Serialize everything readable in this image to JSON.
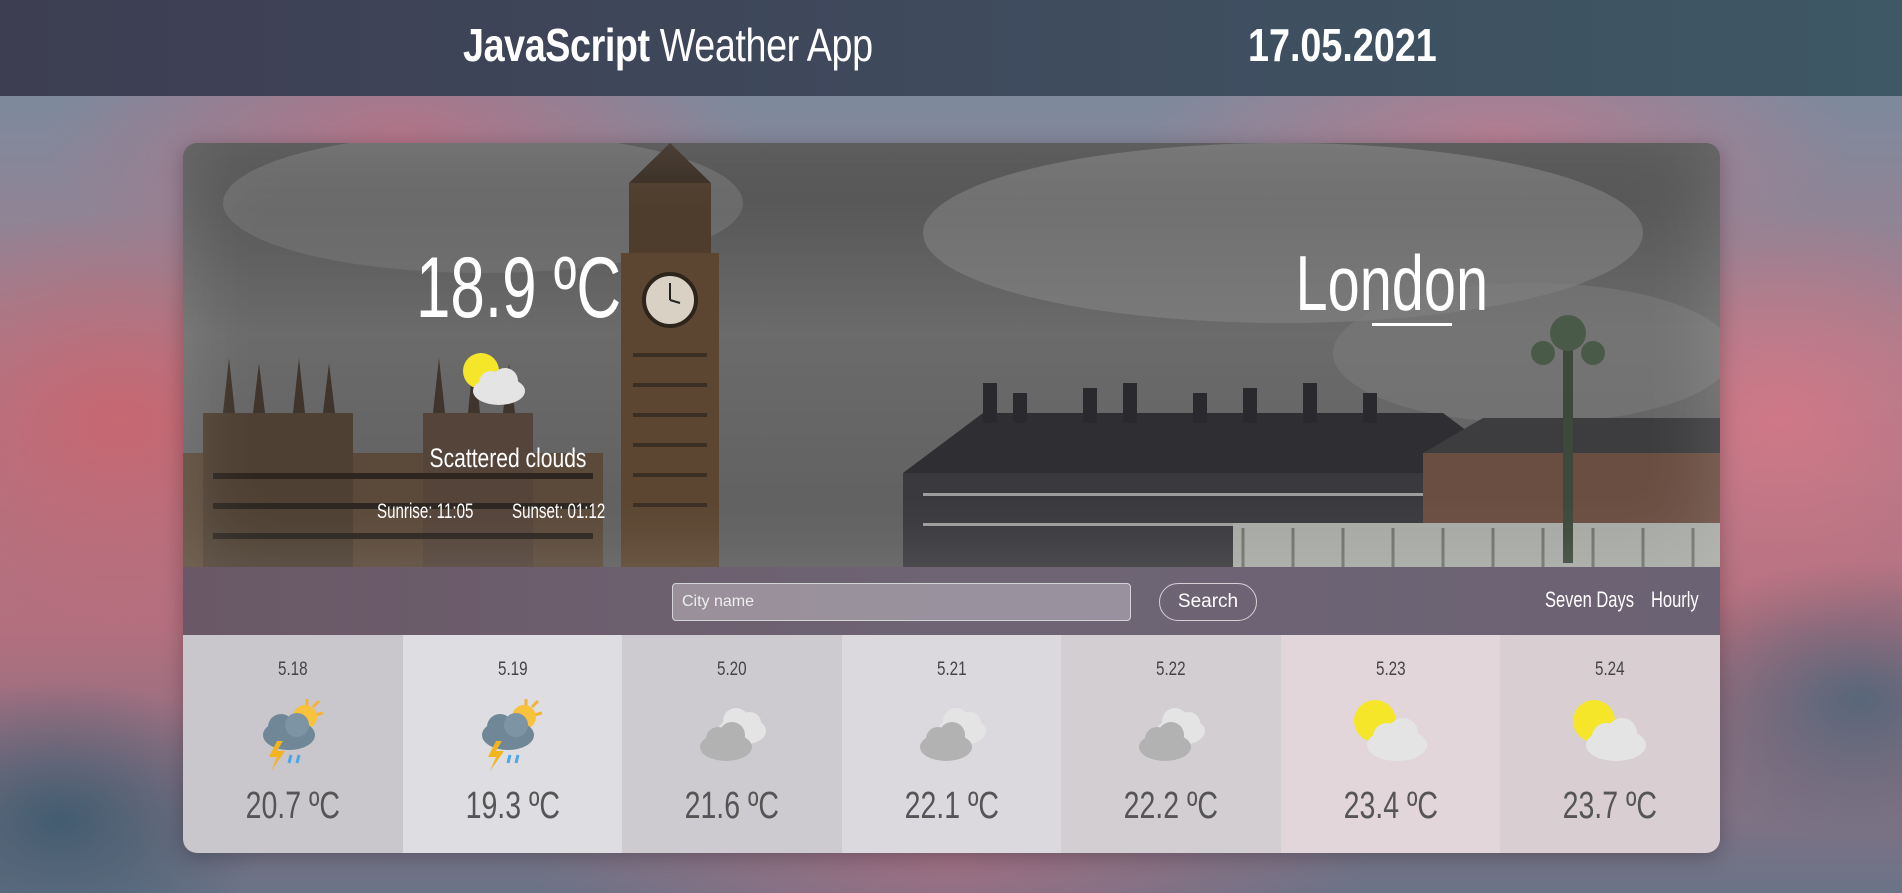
{
  "header": {
    "title_bold": "JavaScript",
    "title_light": "Weather App",
    "date": "17.05.2021"
  },
  "current": {
    "temperature": "18.9 ºC",
    "condition": "Scattered clouds",
    "icon": "sun-behind-cloud-icon",
    "sunrise": "Sunrise: 11:05",
    "sunset": "Sunset: 01:12",
    "city": "London"
  },
  "search": {
    "placeholder": "City name",
    "value": "",
    "button_label": "Search"
  },
  "tabs": [
    "Seven Days",
    "Hourly"
  ],
  "forecast": [
    {
      "date": "5.18",
      "temp": "20.7 ºC",
      "icon": "thunderstorm-sun-icon",
      "bg": "#c9c6cc"
    },
    {
      "date": "5.19",
      "temp": "19.3 ºC",
      "icon": "thunderstorm-sun-icon",
      "bg": "#dddde2"
    },
    {
      "date": "5.20",
      "temp": "21.6 ºC",
      "icon": "cloudy-icon",
      "bg": "#cdcbd0"
    },
    {
      "date": "5.21",
      "temp": "22.1 ºC",
      "icon": "cloudy-icon",
      "bg": "#dcd9de"
    },
    {
      "date": "5.22",
      "temp": "22.2 ºC",
      "icon": "cloudy-icon",
      "bg": "#d2ced2"
    },
    {
      "date": "5.23",
      "temp": "23.4 ºC",
      "icon": "sun-behind-cloud-icon",
      "bg": "#e3d6da"
    },
    {
      "date": "5.24",
      "temp": "23.7 ºC",
      "icon": "sun-behind-cloud-icon",
      "bg": "#d9cfd3"
    }
  ]
}
